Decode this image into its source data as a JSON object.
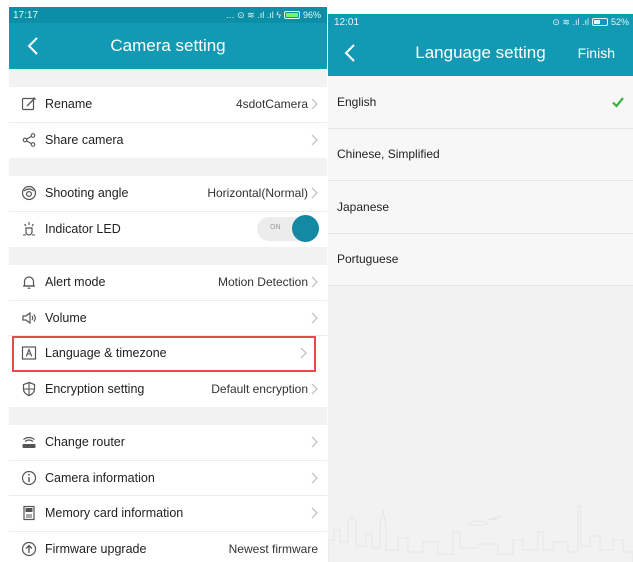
{
  "left_screen": {
    "status_bar": {
      "time": "17:17",
      "icons": "… ⊙ ≋ .ıl .ıl ϟ",
      "battery": "96%",
      "battery_level": 0.96
    },
    "header": {
      "title": "Camera setting"
    },
    "groups": [
      [
        {
          "label": "Rename",
          "value": "4sdotCamera",
          "icon": "edit-icon",
          "chevron": true
        },
        {
          "label": "Share camera",
          "value": "",
          "icon": "share-icon",
          "chevron": true
        }
      ],
      [
        {
          "label": "Shooting angle",
          "value": "Horizontal(Normal)",
          "icon": "camera-angle-icon",
          "chevron": true
        },
        {
          "label": "Indicator LED",
          "value": "",
          "icon": "led-icon",
          "toggle": {
            "label": "ON",
            "state": true
          }
        }
      ],
      [
        {
          "label": "Alert mode",
          "value": "Motion Detection",
          "icon": "bell-icon",
          "chevron": true
        },
        {
          "label": "Volume",
          "value": "",
          "icon": "speaker-icon",
          "chevron": true
        },
        {
          "label": "Language & timezone",
          "value": "",
          "icon": "language-icon",
          "chevron": true,
          "highlighted": true
        },
        {
          "label": "Encryption setting",
          "value": "Default encryption",
          "icon": "shield-icon",
          "chevron": true
        }
      ],
      [
        {
          "label": "Change router",
          "value": "",
          "icon": "router-icon",
          "chevron": true
        },
        {
          "label": "Camera information",
          "value": "",
          "icon": "info-icon",
          "chevron": true
        },
        {
          "label": "Memory card information",
          "value": "",
          "icon": "sd-card-icon",
          "chevron": true
        },
        {
          "label": "Firmware upgrade",
          "value": "Newest firmware",
          "icon": "upgrade-icon",
          "chevron": false
        }
      ]
    ]
  },
  "right_screen": {
    "status_bar": {
      "time": "12:01",
      "icons": "⊙ ≋ .ıl .ıl",
      "battery": "52%",
      "battery_level": 0.52
    },
    "header": {
      "title": "Language setting",
      "finish_label": "Finish"
    },
    "languages": [
      {
        "label": "English",
        "selected": true
      },
      {
        "label": "Chinese, Simplified",
        "selected": false
      },
      {
        "label": "Japanese",
        "selected": false
      },
      {
        "label": "Portuguese",
        "selected": false
      }
    ]
  },
  "colors": {
    "header": "#1299b3",
    "status_left": "#0b8fa6",
    "highlight": "#e84b4b",
    "check": "#3cb043",
    "toggle_knob": "#1389a3"
  }
}
